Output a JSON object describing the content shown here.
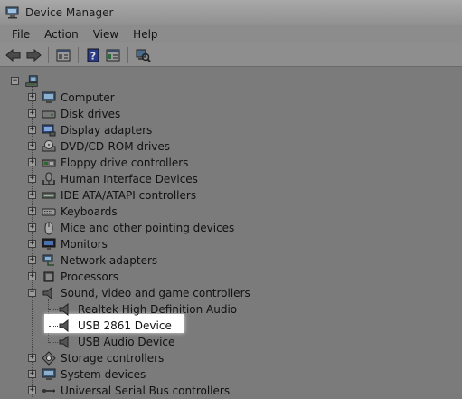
{
  "window": {
    "title": "Device Manager"
  },
  "menu": [
    "File",
    "Action",
    "View",
    "Help"
  ],
  "toolbar": {
    "icons": [
      "back-arrow-icon",
      "forward-arrow-icon",
      "properties-icon",
      "help-icon",
      "console-tree-icon",
      "scan-hardware-icon"
    ]
  },
  "tree": {
    "categories": [
      {
        "label": "Computer",
        "icon": "computer-icon"
      },
      {
        "label": "Disk drives",
        "icon": "disk-drive-icon"
      },
      {
        "label": "Display adapters",
        "icon": "display-adapter-icon"
      },
      {
        "label": "DVD/CD-ROM drives",
        "icon": "dvd-drive-icon"
      },
      {
        "label": "Floppy drive controllers",
        "icon": "floppy-controller-icon"
      },
      {
        "label": "Human Interface Devices",
        "icon": "hid-icon"
      },
      {
        "label": "IDE ATA/ATAPI controllers",
        "icon": "ide-controller-icon"
      },
      {
        "label": "Keyboards",
        "icon": "keyboard-icon"
      },
      {
        "label": "Mice and other pointing devices",
        "icon": "mouse-icon"
      },
      {
        "label": "Monitors",
        "icon": "monitor-icon"
      },
      {
        "label": "Network adapters",
        "icon": "network-adapter-icon"
      },
      {
        "label": "Processors",
        "icon": "processor-icon"
      },
      {
        "label": "Sound, video and game controllers",
        "icon": "speaker-icon",
        "expanded": true,
        "children": [
          {
            "label": "Realtek High Definition Audio",
            "icon": "speaker-icon"
          },
          {
            "label": "USB 2861 Device",
            "icon": "speaker-icon",
            "selected": true
          },
          {
            "label": "USB Audio Device",
            "icon": "speaker-icon"
          }
        ]
      },
      {
        "label": "Storage controllers",
        "icon": "storage-controller-icon"
      },
      {
        "label": "System devices",
        "icon": "system-devices-icon"
      },
      {
        "label": "Universal Serial Bus controllers",
        "icon": "usb-controller-icon"
      }
    ]
  }
}
